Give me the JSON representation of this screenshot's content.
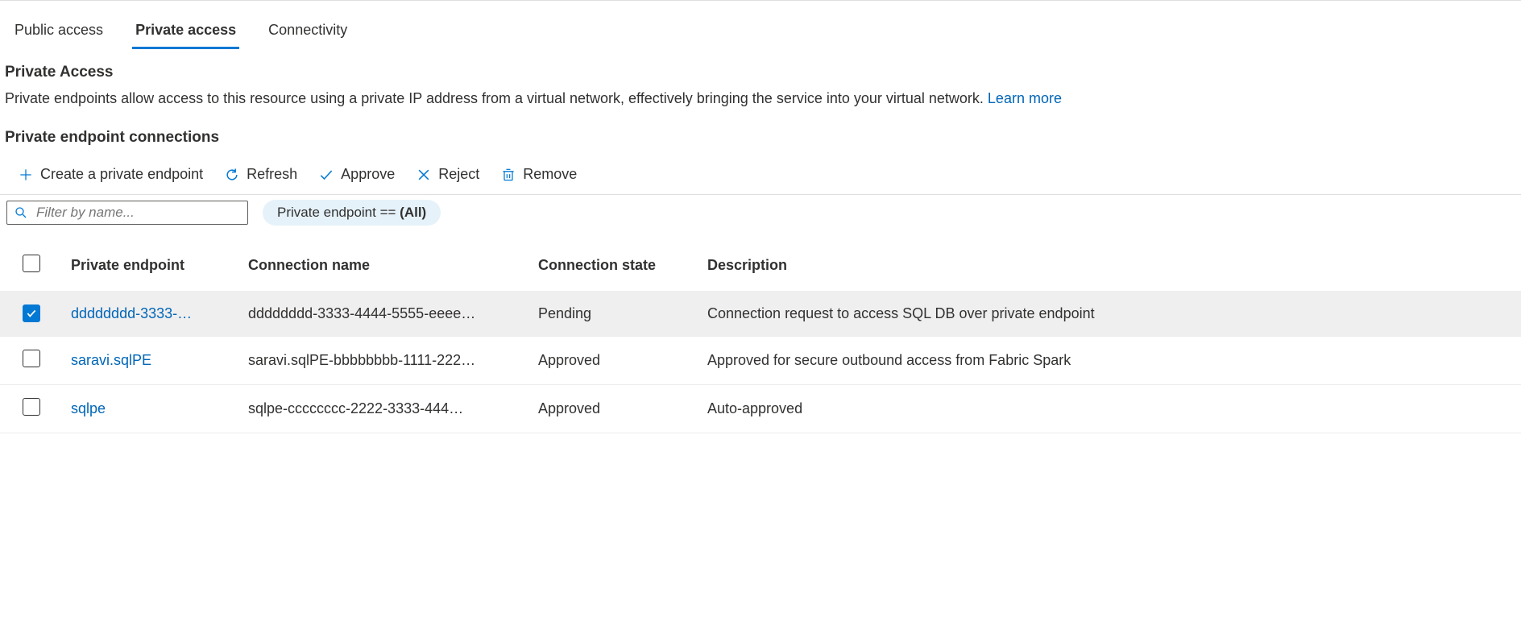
{
  "tabs": [
    {
      "label": "Public access",
      "active": false
    },
    {
      "label": "Private access",
      "active": true
    },
    {
      "label": "Connectivity",
      "active": false
    }
  ],
  "privateAccess": {
    "title": "Private Access",
    "description": "Private endpoints allow access to this resource using a private IP address from a virtual network, effectively bringing the service into your virtual network. ",
    "learnMore": "Learn more"
  },
  "connections": {
    "title": "Private endpoint connections",
    "toolbar": {
      "create": "Create a private endpoint",
      "refresh": "Refresh",
      "approve": "Approve",
      "reject": "Reject",
      "remove": "Remove"
    },
    "search": {
      "placeholder": "Filter by name..."
    },
    "filterPill": {
      "prefix": "Private endpoint == ",
      "value": "(All)"
    },
    "columns": {
      "pe": "Private endpoint",
      "conn": "Connection name",
      "state": "Connection state",
      "desc": "Description"
    },
    "rows": [
      {
        "checked": true,
        "pe": "dddddddd-3333-…",
        "conn": "dddddddd-3333-4444-5555-eeee…",
        "state": "Pending",
        "desc": "Connection request to access SQL DB over private endpoint"
      },
      {
        "checked": false,
        "pe": "saravi.sqlPE",
        "conn": "saravi.sqlPE-bbbbbbbb-1111-222…",
        "state": "Approved",
        "desc": "Approved for secure outbound access from Fabric Spark"
      },
      {
        "checked": false,
        "pe": "sqlpe",
        "conn": "sqlpe-cccccccc-2222-3333-444…",
        "state": "Approved",
        "desc": "Auto-approved"
      }
    ]
  }
}
